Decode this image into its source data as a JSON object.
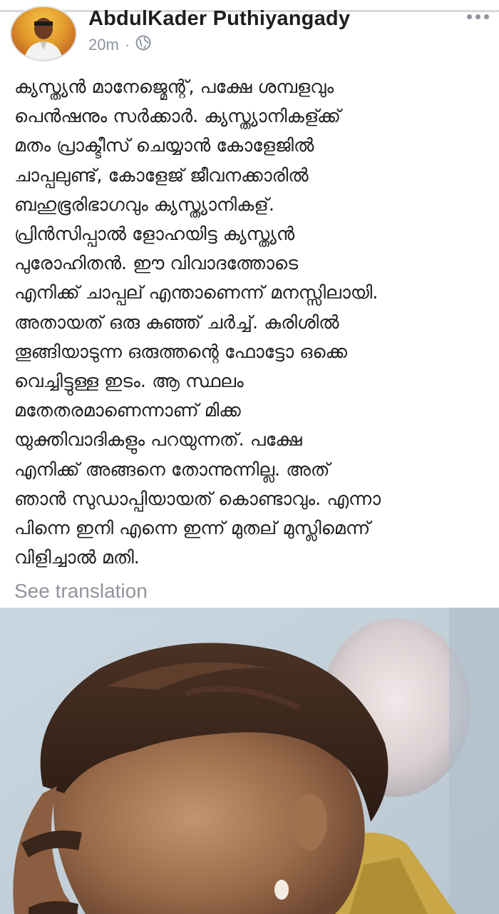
{
  "post": {
    "author": "AbdulKader Puthiyangady",
    "time": "20m",
    "separator": "·",
    "icons": {
      "avatar": "profile-photo",
      "privacy": "globe-icon",
      "menu": "more-options-icon"
    },
    "lines": [
      "ക്യസ്ത്യൻ മാനേജ്മെന്റ്, പക്ഷേ ശമ്പളവും",
      "പെൻഷനും സർക്കാർ.  ക്യസ്ത്യാനികള്ക്ക്",
      "മതം പ്രാക്ടീസ് ചെയ്യാൻ കോളേജിൽ",
      "ചാപ്പലുണ്ട്, കോളേജ് ജീവനക്കാരിൽ",
      "ബഹുഭൂരിഭാഗവും ക്യസ്ത്യാനികള്.",
      "പ്രിൻസിപ്പാൽ ളോഹയിട്ട ക്യസ്ത്യൻ",
      "പുരോഹിതൻ.   ഈ വിവാദത്തോടെ",
      "എനിക്ക് ചാപ്പല് എന്താണെന്ന് മനസ്സിലായി.",
      "അതായത് ഒരു കുഞ്ഞ് ചർച്ച്.  കുരിശിൽ",
      "തൂങ്ങിയാടുന്ന ഒരുത്തന്റെ ഫോട്ടോ ഒക്കെ",
      "വെച്ചിട്ടുള്ള ഇടം.  ആ സ്ഥലം",
      "മതേതരമാണെന്നാണ് മിക്ക",
      "യുക്തിവാദികളും പറയുന്നത്. പക്ഷേ",
      "എനിക്ക് അങ്ങനെ തോന്നുന്നില്ല. അത്",
      "ഞാൻ സുഡാപ്പിയായത് കൊണ്ടാവും. എന്നാ",
      "പിന്നെ ഇനി എന്നെ ഇന്ന് മുതല് മുസ്ലിമെന്ന്",
      "വിളിച്ചാൽ മതി."
    ],
    "see_translation": "See translation",
    "colors": {
      "name": "#1c1e21",
      "meta": "#8d949e",
      "link": "#90949c",
      "divider": "#d7d9dc"
    }
  }
}
